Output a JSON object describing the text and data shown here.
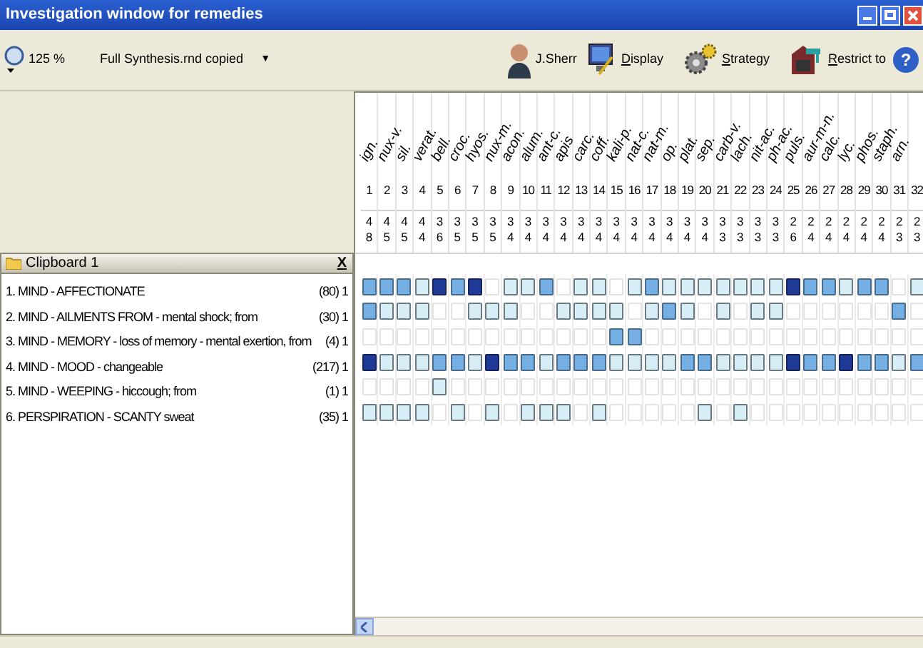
{
  "window": {
    "title": "Investigation window for remedies"
  },
  "toolbar": {
    "zoom": "125 %",
    "repertory": "Full Synthesis.rnd copied",
    "dropdown": "▼",
    "help": "?",
    "user": "J.Sherr",
    "buttons": [
      {
        "label": "Display",
        "kind": "display"
      },
      {
        "label": "Strategy",
        "kind": "strategy"
      },
      {
        "label": "Restrict to",
        "kind": "restrict"
      }
    ]
  },
  "clipboard": {
    "title": "Clipboard 1",
    "close": "X",
    "rubrics": [
      {
        "text": "1. MIND - AFFECTIONATE",
        "count": "(80) 1",
        "grades": [
          {
            "kind": "medium"
          },
          {
            "kind": "medium"
          },
          {
            "kind": "medium"
          },
          {
            "kind": "light"
          },
          {
            "kind": "dark"
          },
          {
            "kind": "medium"
          },
          {
            "kind": "dark"
          },
          {
            "kind": "empty"
          },
          {
            "kind": "light"
          },
          {
            "kind": "light"
          },
          {
            "kind": "medium"
          },
          {
            "kind": "empty"
          },
          {
            "kind": "light"
          },
          {
            "kind": "light"
          },
          {
            "kind": "empty"
          },
          {
            "kind": "light"
          },
          {
            "kind": "medium"
          },
          {
            "kind": "light"
          },
          {
            "kind": "light"
          },
          {
            "kind": "light"
          },
          {
            "kind": "light"
          },
          {
            "kind": "light"
          },
          {
            "kind": "light"
          },
          {
            "kind": "light"
          },
          {
            "kind": "dark"
          },
          {
            "kind": "medium"
          },
          {
            "kind": "medium"
          },
          {
            "kind": "light"
          },
          {
            "kind": "medium"
          },
          {
            "kind": "medium"
          },
          {
            "kind": "empty"
          },
          {
            "kind": "light"
          }
        ]
      },
      {
        "text": "2. MIND - AILMENTS FROM - mental shock; from",
        "count": "(30) 1",
        "grades": [
          {
            "kind": "medium"
          },
          {
            "kind": "light"
          },
          {
            "kind": "light"
          },
          {
            "kind": "light"
          },
          {
            "kind": "empty"
          },
          {
            "kind": "empty"
          },
          {
            "kind": "light"
          },
          {
            "kind": "light"
          },
          {
            "kind": "light"
          },
          {
            "kind": "empty"
          },
          {
            "kind": "empty"
          },
          {
            "kind": "light"
          },
          {
            "kind": "light"
          },
          {
            "kind": "light"
          },
          {
            "kind": "light"
          },
          {
            "kind": "empty"
          },
          {
            "kind": "light"
          },
          {
            "kind": "medium"
          },
          {
            "kind": "light"
          },
          {
            "kind": "empty"
          },
          {
            "kind": "light"
          },
          {
            "kind": "empty"
          },
          {
            "kind": "light"
          },
          {
            "kind": "light"
          },
          {
            "kind": "empty"
          },
          {
            "kind": "empty"
          },
          {
            "kind": "empty"
          },
          {
            "kind": "empty"
          },
          {
            "kind": "empty"
          },
          {
            "kind": "empty"
          },
          {
            "kind": "medium"
          },
          {
            "kind": "empty"
          }
        ]
      },
      {
        "text": "3. MIND - MEMORY - loss of memory - mental exertion, from",
        "count": "(4) 1",
        "grades": [
          {
            "kind": "empty"
          },
          {
            "kind": "empty"
          },
          {
            "kind": "empty"
          },
          {
            "kind": "empty"
          },
          {
            "kind": "empty"
          },
          {
            "kind": "empty"
          },
          {
            "kind": "empty"
          },
          {
            "kind": "empty"
          },
          {
            "kind": "empty"
          },
          {
            "kind": "empty"
          },
          {
            "kind": "empty"
          },
          {
            "kind": "empty"
          },
          {
            "kind": "empty"
          },
          {
            "kind": "empty"
          },
          {
            "kind": "medium"
          },
          {
            "kind": "medium"
          },
          {
            "kind": "empty"
          },
          {
            "kind": "empty"
          },
          {
            "kind": "empty"
          },
          {
            "kind": "empty"
          },
          {
            "kind": "empty"
          },
          {
            "kind": "empty"
          },
          {
            "kind": "empty"
          },
          {
            "kind": "empty"
          },
          {
            "kind": "empty"
          },
          {
            "kind": "empty"
          },
          {
            "kind": "empty"
          },
          {
            "kind": "empty"
          },
          {
            "kind": "empty"
          },
          {
            "kind": "empty"
          },
          {
            "kind": "empty"
          },
          {
            "kind": "empty"
          }
        ]
      },
      {
        "text": "4. MIND - MOOD - changeable",
        "count": "(217) 1",
        "grades": [
          {
            "kind": "dark"
          },
          {
            "kind": "light"
          },
          {
            "kind": "light"
          },
          {
            "kind": "light"
          },
          {
            "kind": "medium"
          },
          {
            "kind": "medium"
          },
          {
            "kind": "light"
          },
          {
            "kind": "dark"
          },
          {
            "kind": "medium"
          },
          {
            "kind": "medium"
          },
          {
            "kind": "light"
          },
          {
            "kind": "medium"
          },
          {
            "kind": "medium"
          },
          {
            "kind": "medium"
          },
          {
            "kind": "light"
          },
          {
            "kind": "light"
          },
          {
            "kind": "light"
          },
          {
            "kind": "light"
          },
          {
            "kind": "medium"
          },
          {
            "kind": "medium"
          },
          {
            "kind": "light"
          },
          {
            "kind": "light"
          },
          {
            "kind": "light"
          },
          {
            "kind": "light"
          },
          {
            "kind": "dark"
          },
          {
            "kind": "medium"
          },
          {
            "kind": "medium"
          },
          {
            "kind": "dark"
          },
          {
            "kind": "medium"
          },
          {
            "kind": "medium"
          },
          {
            "kind": "light"
          },
          {
            "kind": "medium"
          }
        ]
      },
      {
        "text": "5. MIND - WEEPING - hiccough; from",
        "count": "(1) 1",
        "grades": [
          {
            "kind": "empty"
          },
          {
            "kind": "empty"
          },
          {
            "kind": "empty"
          },
          {
            "kind": "empty"
          },
          {
            "kind": "light"
          },
          {
            "kind": "empty"
          },
          {
            "kind": "empty"
          },
          {
            "kind": "empty"
          },
          {
            "kind": "empty"
          },
          {
            "kind": "empty"
          },
          {
            "kind": "empty"
          },
          {
            "kind": "empty"
          },
          {
            "kind": "empty"
          },
          {
            "kind": "empty"
          },
          {
            "kind": "empty"
          },
          {
            "kind": "empty"
          },
          {
            "kind": "empty"
          },
          {
            "kind": "empty"
          },
          {
            "kind": "empty"
          },
          {
            "kind": "empty"
          },
          {
            "kind": "empty"
          },
          {
            "kind": "empty"
          },
          {
            "kind": "empty"
          },
          {
            "kind": "empty"
          },
          {
            "kind": "empty"
          },
          {
            "kind": "empty"
          },
          {
            "kind": "empty"
          },
          {
            "kind": "empty"
          },
          {
            "kind": "empty"
          },
          {
            "kind": "empty"
          },
          {
            "kind": "empty"
          },
          {
            "kind": "empty"
          }
        ]
      },
      {
        "text": "6. PERSPIRATION - SCANTY sweat",
        "count": "(35) 1",
        "grades": [
          {
            "kind": "light"
          },
          {
            "kind": "light"
          },
          {
            "kind": "light"
          },
          {
            "kind": "light"
          },
          {
            "kind": "empty"
          },
          {
            "kind": "light"
          },
          {
            "kind": "empty"
          },
          {
            "kind": "light"
          },
          {
            "kind": "empty"
          },
          {
            "kind": "light"
          },
          {
            "kind": "light"
          },
          {
            "kind": "light"
          },
          {
            "kind": "empty"
          },
          {
            "kind": "light"
          },
          {
            "kind": "empty"
          },
          {
            "kind": "empty"
          },
          {
            "kind": "empty"
          },
          {
            "kind": "empty"
          },
          {
            "kind": "empty"
          },
          {
            "kind": "light"
          },
          {
            "kind": "empty"
          },
          {
            "kind": "light"
          },
          {
            "kind": "empty"
          },
          {
            "kind": "empty"
          },
          {
            "kind": "empty"
          },
          {
            "kind": "empty"
          },
          {
            "kind": "empty"
          },
          {
            "kind": "empty"
          },
          {
            "kind": "empty"
          },
          {
            "kind": "empty"
          },
          {
            "kind": "empty"
          },
          {
            "kind": "empty"
          }
        ]
      }
    ]
  },
  "remedies": [
    {
      "name": "ign.",
      "number": "1",
      "degree": "4",
      "count": "8"
    },
    {
      "name": "nux-v.",
      "number": "2",
      "degree": "4",
      "count": "5"
    },
    {
      "name": "sil.",
      "number": "3",
      "degree": "4",
      "count": "5"
    },
    {
      "name": "verat.",
      "number": "4",
      "degree": "4",
      "count": "4"
    },
    {
      "name": "bell.",
      "number": "5",
      "degree": "3",
      "count": "6"
    },
    {
      "name": "croc.",
      "number": "6",
      "degree": "3",
      "count": "5"
    },
    {
      "name": "hyos.",
      "number": "7",
      "degree": "3",
      "count": "5"
    },
    {
      "name": "nux-m.",
      "number": "8",
      "degree": "3",
      "count": "5"
    },
    {
      "name": "acon.",
      "number": "9",
      "degree": "3",
      "count": "4"
    },
    {
      "name": "alum.",
      "number": "10",
      "degree": "3",
      "count": "4"
    },
    {
      "name": "ant-c.",
      "number": "11",
      "degree": "3",
      "count": "4"
    },
    {
      "name": "apis",
      "number": "12",
      "degree": "3",
      "count": "4"
    },
    {
      "name": "carc.",
      "number": "13",
      "degree": "3",
      "count": "4"
    },
    {
      "name": "coff.",
      "number": "14",
      "degree": "3",
      "count": "4"
    },
    {
      "name": "kali-p.",
      "number": "15",
      "degree": "3",
      "count": "4"
    },
    {
      "name": "nat-c.",
      "number": "16",
      "degree": "3",
      "count": "4"
    },
    {
      "name": "nat-m.",
      "number": "17",
      "degree": "3",
      "count": "4"
    },
    {
      "name": "op.",
      "number": "18",
      "degree": "3",
      "count": "4"
    },
    {
      "name": "plat.",
      "number": "19",
      "degree": "3",
      "count": "4"
    },
    {
      "name": "sep.",
      "number": "20",
      "degree": "3",
      "count": "4"
    },
    {
      "name": "carb-v.",
      "number": "21",
      "degree": "3",
      "count": "3"
    },
    {
      "name": "lach.",
      "number": "22",
      "degree": "3",
      "count": "3"
    },
    {
      "name": "nit-ac.",
      "number": "23",
      "degree": "3",
      "count": "3"
    },
    {
      "name": "ph-ac.",
      "number": "24",
      "degree": "3",
      "count": "3"
    },
    {
      "name": "puls.",
      "number": "25",
      "degree": "2",
      "count": "6"
    },
    {
      "name": "aur-m-n.",
      "number": "26",
      "degree": "2",
      "count": "4"
    },
    {
      "name": "calc.",
      "number": "27",
      "degree": "2",
      "count": "4"
    },
    {
      "name": "lyc.",
      "number": "28",
      "degree": "2",
      "count": "4"
    },
    {
      "name": "phos.",
      "number": "29",
      "degree": "2",
      "count": "4"
    },
    {
      "name": "staph.",
      "number": "30",
      "degree": "2",
      "count": "4"
    },
    {
      "name": "arn.",
      "number": "31",
      "degree": "2",
      "count": "3"
    },
    {
      "number": "32",
      "degree": "2",
      "count": "3"
    }
  ]
}
